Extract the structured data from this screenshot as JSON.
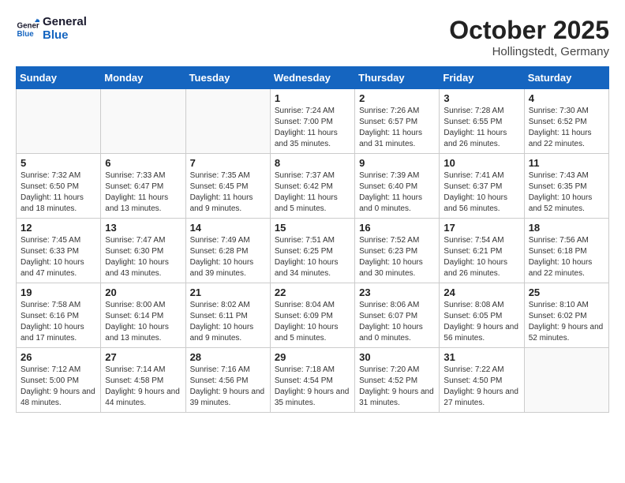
{
  "header": {
    "logo_line1": "General",
    "logo_line2": "Blue",
    "month": "October 2025",
    "location": "Hollingstedt, Germany"
  },
  "weekdays": [
    "Sunday",
    "Monday",
    "Tuesday",
    "Wednesday",
    "Thursday",
    "Friday",
    "Saturday"
  ],
  "weeks": [
    [
      {
        "day": "",
        "info": ""
      },
      {
        "day": "",
        "info": ""
      },
      {
        "day": "",
        "info": ""
      },
      {
        "day": "1",
        "info": "Sunrise: 7:24 AM\nSunset: 7:00 PM\nDaylight: 11 hours and 35 minutes."
      },
      {
        "day": "2",
        "info": "Sunrise: 7:26 AM\nSunset: 6:57 PM\nDaylight: 11 hours and 31 minutes."
      },
      {
        "day": "3",
        "info": "Sunrise: 7:28 AM\nSunset: 6:55 PM\nDaylight: 11 hours and 26 minutes."
      },
      {
        "day": "4",
        "info": "Sunrise: 7:30 AM\nSunset: 6:52 PM\nDaylight: 11 hours and 22 minutes."
      }
    ],
    [
      {
        "day": "5",
        "info": "Sunrise: 7:32 AM\nSunset: 6:50 PM\nDaylight: 11 hours and 18 minutes."
      },
      {
        "day": "6",
        "info": "Sunrise: 7:33 AM\nSunset: 6:47 PM\nDaylight: 11 hours and 13 minutes."
      },
      {
        "day": "7",
        "info": "Sunrise: 7:35 AM\nSunset: 6:45 PM\nDaylight: 11 hours and 9 minutes."
      },
      {
        "day": "8",
        "info": "Sunrise: 7:37 AM\nSunset: 6:42 PM\nDaylight: 11 hours and 5 minutes."
      },
      {
        "day": "9",
        "info": "Sunrise: 7:39 AM\nSunset: 6:40 PM\nDaylight: 11 hours and 0 minutes."
      },
      {
        "day": "10",
        "info": "Sunrise: 7:41 AM\nSunset: 6:37 PM\nDaylight: 10 hours and 56 minutes."
      },
      {
        "day": "11",
        "info": "Sunrise: 7:43 AM\nSunset: 6:35 PM\nDaylight: 10 hours and 52 minutes."
      }
    ],
    [
      {
        "day": "12",
        "info": "Sunrise: 7:45 AM\nSunset: 6:33 PM\nDaylight: 10 hours and 47 minutes."
      },
      {
        "day": "13",
        "info": "Sunrise: 7:47 AM\nSunset: 6:30 PM\nDaylight: 10 hours and 43 minutes."
      },
      {
        "day": "14",
        "info": "Sunrise: 7:49 AM\nSunset: 6:28 PM\nDaylight: 10 hours and 39 minutes."
      },
      {
        "day": "15",
        "info": "Sunrise: 7:51 AM\nSunset: 6:25 PM\nDaylight: 10 hours and 34 minutes."
      },
      {
        "day": "16",
        "info": "Sunrise: 7:52 AM\nSunset: 6:23 PM\nDaylight: 10 hours and 30 minutes."
      },
      {
        "day": "17",
        "info": "Sunrise: 7:54 AM\nSunset: 6:21 PM\nDaylight: 10 hours and 26 minutes."
      },
      {
        "day": "18",
        "info": "Sunrise: 7:56 AM\nSunset: 6:18 PM\nDaylight: 10 hours and 22 minutes."
      }
    ],
    [
      {
        "day": "19",
        "info": "Sunrise: 7:58 AM\nSunset: 6:16 PM\nDaylight: 10 hours and 17 minutes."
      },
      {
        "day": "20",
        "info": "Sunrise: 8:00 AM\nSunset: 6:14 PM\nDaylight: 10 hours and 13 minutes."
      },
      {
        "day": "21",
        "info": "Sunrise: 8:02 AM\nSunset: 6:11 PM\nDaylight: 10 hours and 9 minutes."
      },
      {
        "day": "22",
        "info": "Sunrise: 8:04 AM\nSunset: 6:09 PM\nDaylight: 10 hours and 5 minutes."
      },
      {
        "day": "23",
        "info": "Sunrise: 8:06 AM\nSunset: 6:07 PM\nDaylight: 10 hours and 0 minutes."
      },
      {
        "day": "24",
        "info": "Sunrise: 8:08 AM\nSunset: 6:05 PM\nDaylight: 9 hours and 56 minutes."
      },
      {
        "day": "25",
        "info": "Sunrise: 8:10 AM\nSunset: 6:02 PM\nDaylight: 9 hours and 52 minutes."
      }
    ],
    [
      {
        "day": "26",
        "info": "Sunrise: 7:12 AM\nSunset: 5:00 PM\nDaylight: 9 hours and 48 minutes."
      },
      {
        "day": "27",
        "info": "Sunrise: 7:14 AM\nSunset: 4:58 PM\nDaylight: 9 hours and 44 minutes."
      },
      {
        "day": "28",
        "info": "Sunrise: 7:16 AM\nSunset: 4:56 PM\nDaylight: 9 hours and 39 minutes."
      },
      {
        "day": "29",
        "info": "Sunrise: 7:18 AM\nSunset: 4:54 PM\nDaylight: 9 hours and 35 minutes."
      },
      {
        "day": "30",
        "info": "Sunrise: 7:20 AM\nSunset: 4:52 PM\nDaylight: 9 hours and 31 minutes."
      },
      {
        "day": "31",
        "info": "Sunrise: 7:22 AM\nSunset: 4:50 PM\nDaylight: 9 hours and 27 minutes."
      },
      {
        "day": "",
        "info": ""
      }
    ]
  ]
}
